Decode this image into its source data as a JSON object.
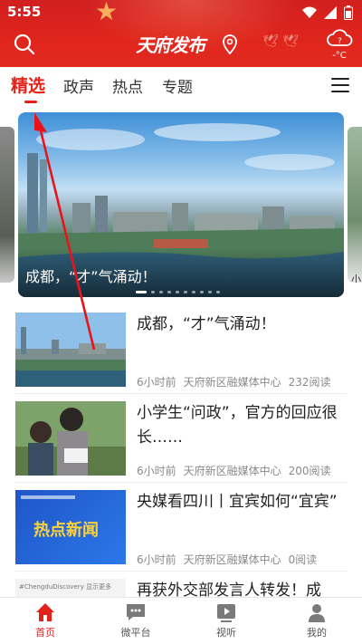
{
  "status_bar": {
    "time": "5:55"
  },
  "header": {
    "logo_text": "天府发布",
    "weather_temp": "-°C"
  },
  "tabs": [
    {
      "label": "精选",
      "active": true
    },
    {
      "label": "政声"
    },
    {
      "label": "热点"
    },
    {
      "label": "专题"
    }
  ],
  "carousel": {
    "main": {
      "caption": "成都，“才”气涌动！"
    },
    "right_peek_char": "小",
    "dot_count": 10,
    "active_dot": 0
  },
  "news": [
    {
      "title": "成都，“才”气涌动！",
      "time": "6小时前",
      "source": "天府新区融媒体中心",
      "reads": "232阅读"
    },
    {
      "title": "小学生“问政”，官方的回应很长……",
      "time": "6小时前",
      "source": "天府新区融媒体中心",
      "reads": "200阅读"
    },
    {
      "title": "央媒看四川丨宜宾如何“宜宾”",
      "time": "6小时前",
      "source": "天府新区融媒体中心",
      "reads": "0阅读",
      "thumb_text": "热点新闻"
    },
    {
      "title": "再获外交部发言人转发！成",
      "thumb_text": "#ChengduDiscovery 显示更多"
    }
  ],
  "bottom_nav": [
    {
      "label": "首页",
      "icon": "home-icon",
      "active": true
    },
    {
      "label": "微平台",
      "icon": "chat-icon"
    },
    {
      "label": "视听",
      "icon": "play-icon"
    },
    {
      "label": "我的",
      "icon": "user-icon"
    }
  ],
  "colors": {
    "brand_red": "#e2231a",
    "header_red": "#d11f1f"
  }
}
